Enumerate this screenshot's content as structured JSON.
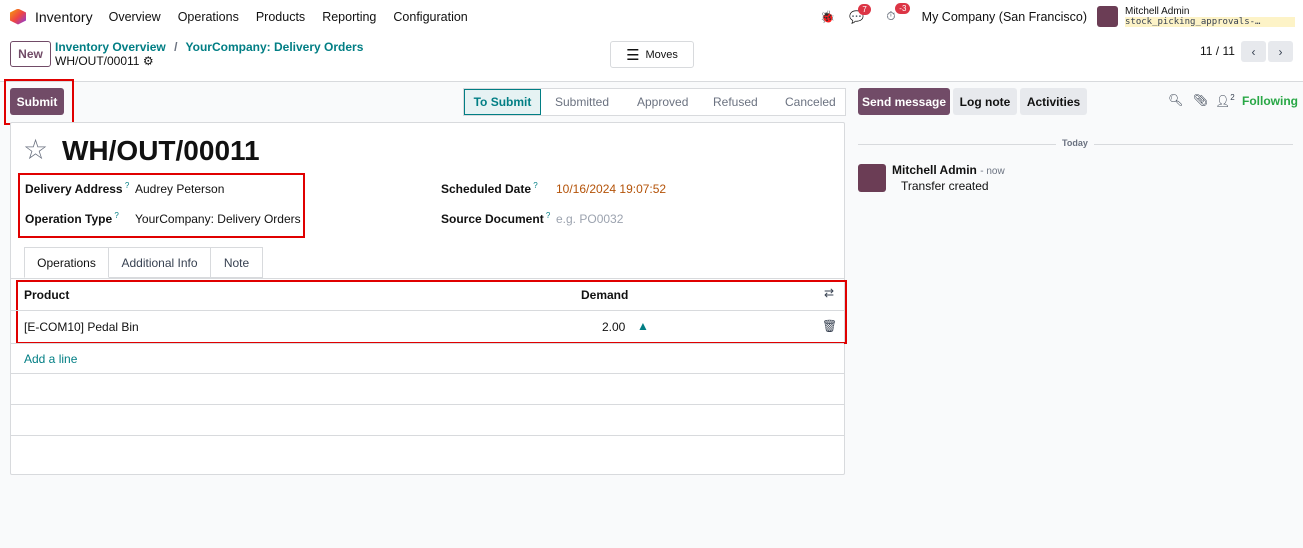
{
  "nav": {
    "app": "Inventory",
    "menus": [
      "Overview",
      "Operations",
      "Products",
      "Reporting",
      "Configuration"
    ],
    "messages_count": "7",
    "activities_count": "-3",
    "company": "My Company (San Francisco)",
    "user": "Mitchell Admin",
    "database": "stock_picking_approvals-…"
  },
  "control": {
    "new": "New",
    "breadcrumbs": [
      "Inventory Overview",
      "YourCompany: Delivery Orders"
    ],
    "record": "WH/OUT/00011",
    "moves": "Moves",
    "pager": "11 / 11"
  },
  "actions": {
    "submit": "Submit",
    "stages": [
      "To Submit",
      "Submitted",
      "Approved",
      "Refused",
      "Canceled"
    ],
    "active_stage": "To Submit"
  },
  "chatter": {
    "send": "Send message",
    "log": "Log note",
    "activities": "Activities",
    "followers": "2",
    "following": "Following",
    "today": "Today",
    "author": "Mitchell Admin",
    "time": "- now",
    "message": "Transfer created"
  },
  "form": {
    "title": "WH/OUT/00011",
    "delivery_address_label": "Delivery Address",
    "delivery_address": "Audrey Peterson",
    "operation_type_label": "Operation Type",
    "operation_type": "YourCompany: Delivery Orders",
    "scheduled_label": "Scheduled Date",
    "scheduled": "10/16/2024 19:07:52",
    "source_label": "Source Document",
    "source_placeholder": "e.g. PO0032",
    "tabs": [
      "Operations",
      "Additional Info",
      "Note"
    ],
    "col_product": "Product",
    "col_demand": "Demand",
    "rows": [
      {
        "product": "[E-COM10] Pedal Bin",
        "demand": "2.00"
      }
    ],
    "add_line": "Add a line"
  }
}
